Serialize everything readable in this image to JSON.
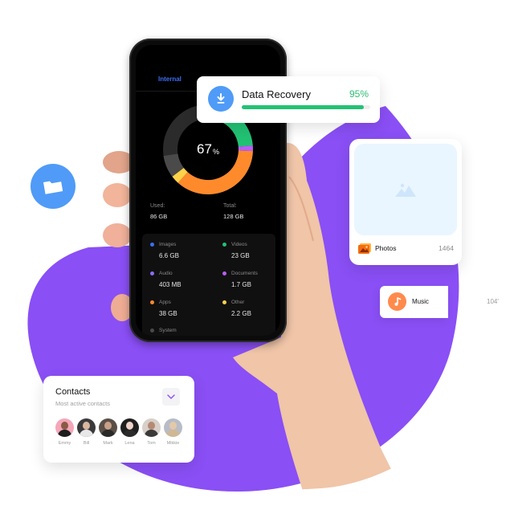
{
  "phone": {
    "tab_label": "Internal",
    "usage_percent": 67,
    "usage_percent_sign": "%",
    "used_label": "Used:",
    "used_value": "86 GB",
    "total_label": "Total:",
    "total_value": "128 GB",
    "categories": [
      {
        "name": "Images",
        "size": "6.6 GB",
        "color": "#3b6ff5"
      },
      {
        "name": "Videos",
        "size": "23 GB",
        "color": "#22c273"
      },
      {
        "name": "Audio",
        "size": "403 MB",
        "color": "#8b6cf6"
      },
      {
        "name": "Documents",
        "size": "1.7 GB",
        "color": "#b95ff5"
      },
      {
        "name": "Apps",
        "size": "38 GB",
        "color": "#ff8a2b"
      },
      {
        "name": "Other",
        "size": "2.2 GB",
        "color": "#ffd24a"
      },
      {
        "name": "System",
        "size": "",
        "color": "#4a4a4a"
      }
    ],
    "donut_segments": [
      {
        "name": "Videos",
        "fraction": 0.18,
        "color": "#22c273"
      },
      {
        "name": "Documents",
        "fraction": 0.02,
        "color": "#b95ff5"
      },
      {
        "name": "Apps",
        "fraction": 0.36,
        "color": "#ff8a2b"
      },
      {
        "name": "Other",
        "fraction": 0.03,
        "color": "#ffd24a"
      },
      {
        "name": "System",
        "fraction": 0.08,
        "color": "#4a4a4a"
      }
    ]
  },
  "recovery": {
    "title": "Data Recovery",
    "percent_label": "95%",
    "progress": 0.95
  },
  "photos": {
    "label": "Photos",
    "count": "1464"
  },
  "music": {
    "label": "Music",
    "count": "104'"
  },
  "contacts": {
    "title": "Contacts",
    "subtitle": "Most active contacts",
    "people": [
      {
        "name": "Emmy",
        "bg": "#f4a7b9",
        "skin": "#8a5a44",
        "shirt": "#1d1d1d"
      },
      {
        "name": "Bill",
        "bg": "#3a3a3a",
        "skin": "#d9b8a0",
        "shirt": "#e8e8e8"
      },
      {
        "name": "Mark",
        "bg": "#5a5046",
        "skin": "#c9a08a",
        "shirt": "#2a2a2a"
      },
      {
        "name": "Lena",
        "bg": "#1f1f1f",
        "skin": "#f0d3c8",
        "shirt": "#2b2b2b"
      },
      {
        "name": "Tom",
        "bg": "#d8d0c8",
        "skin": "#b48a74",
        "shirt": "#3a3a3a"
      },
      {
        "name": "Mikkie",
        "bg": "#b8bcc6",
        "skin": "#e3c9a8",
        "shirt": "#d0b896"
      }
    ]
  },
  "colors": {
    "blob": "#8a4ff5",
    "accent_blue": "#4f9bf7",
    "progress_green": "#23c274"
  }
}
